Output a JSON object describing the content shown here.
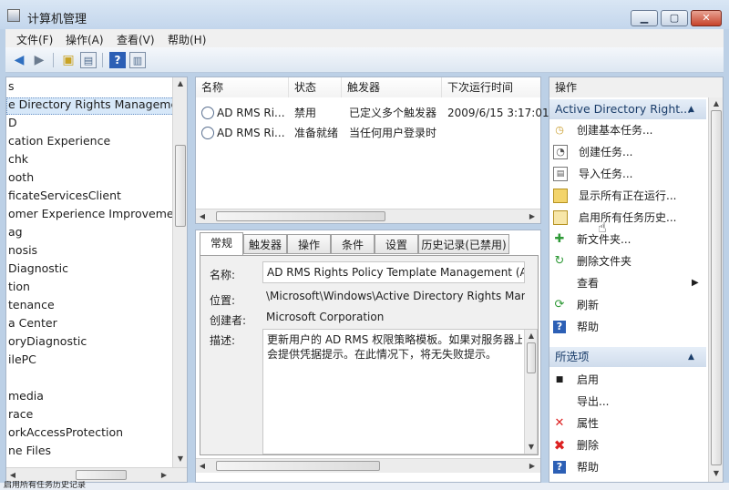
{
  "window": {
    "title": "计算机管理"
  },
  "menu": [
    "文件(F)",
    "操作(A)",
    "查看(V)",
    "帮助(H)"
  ],
  "tree": {
    "items": [
      "s",
      "e Directory Rights Managemen",
      "D",
      "cation Experience",
      "chk",
      "ooth",
      "ficateServicesClient",
      "omer Experience Improvement",
      "ag",
      "nosis",
      "Diagnostic",
      "tion",
      "tenance",
      "a Center",
      "oryDiagnostic",
      "ilePC",
      "",
      "media",
      "race",
      "orkAccessProtection",
      "ne Files"
    ]
  },
  "task_list": {
    "columns": [
      "名称",
      "状态",
      "触发器",
      "下次运行时间"
    ],
    "rows": [
      {
        "name": "AD RMS Ri...",
        "status": "禁用",
        "trigger": "已定义多个触发器",
        "next_run": "2009/6/15 3:17:01"
      },
      {
        "name": "AD RMS Ri...",
        "status": "准备就绪",
        "trigger": "当任何用户登录时",
        "next_run": ""
      }
    ]
  },
  "details": {
    "tabs": [
      "常规",
      "触发器",
      "操作",
      "条件",
      "设置",
      "历史记录(已禁用)"
    ],
    "name_label": "名称:",
    "name_value": "AD RMS Rights Policy Template Management (Autom",
    "location_label": "位置:",
    "location_value": "\\Microsoft\\Windows\\Active Directory Rights Managem",
    "author_label": "创建者:",
    "author_value": "Microsoft Corporation",
    "desc_label": "描述:",
    "desc_line1": "更新用户的 AD RMS 权限策略模板。如果对服务器上模",
    "desc_line2": "会提供凭据提示。在此情况下，将无失败提示。"
  },
  "actions": {
    "header": "操作",
    "section1": "Active Directory Right...",
    "items1": [
      "创建基本任务...",
      "创建任务...",
      "导入任务...",
      "显示所有正在运行...",
      "启用所有任务历史...",
      "新文件夹...",
      "删除文件夹",
      "查看",
      "刷新",
      "帮助"
    ],
    "section2": "所选项",
    "items2": [
      "启用",
      "导出...",
      "属性",
      "删除",
      "帮助"
    ]
  },
  "statusbar": "启用所有任务历史记录"
}
